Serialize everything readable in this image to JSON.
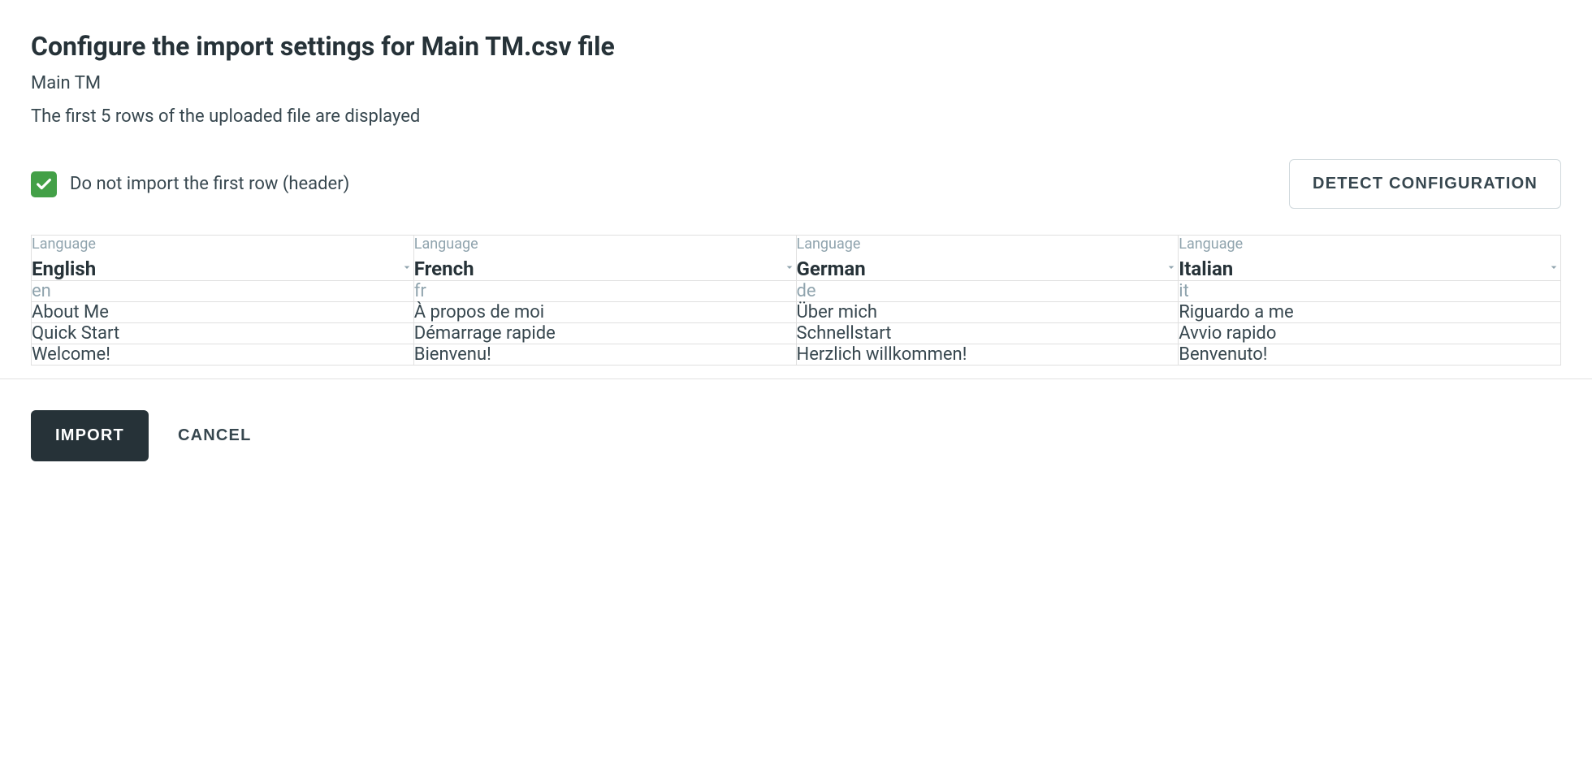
{
  "header": {
    "title": "Configure the import settings for Main TM.csv file",
    "subtitle": "Main TM",
    "description": "The first 5 rows of the uploaded file are displayed"
  },
  "controls": {
    "skip_header_checkbox": {
      "checked": true,
      "label": "Do not import the first row (header)"
    },
    "detect_button": "DETECT CONFIGURATION"
  },
  "table": {
    "column_label": "Language",
    "columns": [
      {
        "language": "English",
        "code": "en"
      },
      {
        "language": "French",
        "code": "fr"
      },
      {
        "language": "German",
        "code": "de"
      },
      {
        "language": "Italian",
        "code": "it"
      }
    ],
    "rows": [
      [
        "en",
        "fr",
        "de",
        "it"
      ],
      [
        "About Me",
        "À propos de moi",
        "Über mich",
        "Riguardo a me"
      ],
      [
        "Quick Start",
        "Démarrage rapide",
        "Schnellstart",
        "Avvio rapido"
      ],
      [
        "Welcome!",
        "Bienvenu!",
        "Herzlich willkommen!",
        "Benvenuto!"
      ]
    ]
  },
  "footer": {
    "import_button": "IMPORT",
    "cancel_button": "CANCEL"
  }
}
